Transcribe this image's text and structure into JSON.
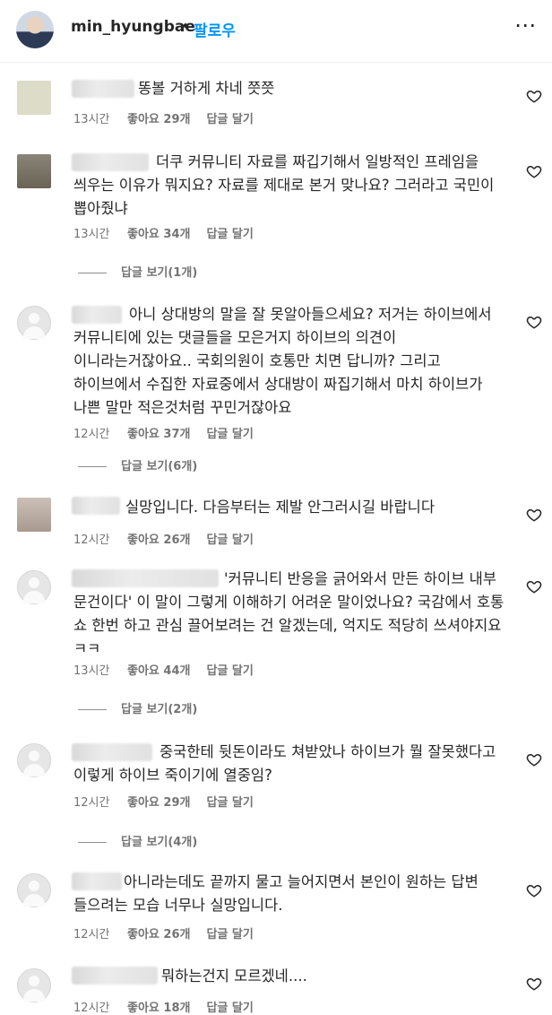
{
  "header": {
    "username": "min_hyungbae",
    "separator": "•",
    "follow_label": "팔로우",
    "more_label": "⋯"
  },
  "comments": [
    {
      "text": "똥볼 거하게 차네 쯧쯧",
      "time": "13시간",
      "likes": "좋아요 29개",
      "reply": "답글 달기",
      "replies": ""
    },
    {
      "text": "더쿠 커뮤니티 자료를 짜깁기해서 일방적인 프레임을 씌우는 이유가 뭐지요? 자료를 제대로 본거 맞나요? 그러라고 국민이 뽑아줬냐",
      "time": "13시간",
      "likes": "좋아요 34개",
      "reply": "답글 달기",
      "replies": "답글 보기(1개)"
    },
    {
      "text": "아니 상대방의 말을 잘 못알아들으세요? 저거는 하이브에서 커뮤니티에 있는 댓글들을 모은거지 하이브의 의견이 이니라는거잖아요.. 국회의원이 호통만 치면 답니까? 그리고 하이브에서 수집한 자료중에서 상대방이 짜집기해서 마치 하이브가 나쁜 말만 적은것처럼 꾸민거잖아요",
      "time": "12시간",
      "likes": "좋아요 37개",
      "reply": "답글 달기",
      "replies": "답글 보기(6개)"
    },
    {
      "text": "실망입니다. 다음부터는 제발 안그러시길 바랍니다",
      "time": "12시간",
      "likes": "좋아요 26개",
      "reply": "답글 달기",
      "replies": ""
    },
    {
      "text": "'커뮤니티 반응을 긁어와서 만든 하이브 내부 문건이다' 이 말이 그렇게 이해하기 어려운 말이었나요? 국감에서 호통 쇼 한번 하고 관심 끌어보려는 건 알겠는데, 억지도 적당히 쓰셔야지요 ㅋㅋ",
      "time": "13시간",
      "likes": "좋아요 44개",
      "reply": "답글 달기",
      "replies": "답글 보기(2개)"
    },
    {
      "text": "중국한테 뒷돈이라도 쳐받았나 하이브가 뭘 잘못했다고 이렇게 하이브 죽이기에 열중임?",
      "time": "12시간",
      "likes": "좋아요 29개",
      "reply": "답글 달기",
      "replies": "답글 보기(4개)"
    },
    {
      "text": "아니라는데도 끝까지 물고 늘어지면서 본인이 원하는 답변 들으려는 모습 너무나 실망입니다.",
      "time": "12시간",
      "likes": "좋아요 26개",
      "reply": "답글 달기",
      "replies": ""
    },
    {
      "text": "뭐하는건지 모르겠네....",
      "time": "12시간",
      "likes": "좋아요 18개",
      "reply": "답글 달기",
      "replies": ""
    }
  ],
  "icons": {
    "heart": "heart-outline-icon",
    "more": "more-horizontal-icon"
  },
  "colors": {
    "follow": "#0095f6",
    "meta": "#737373",
    "text": "#262626"
  }
}
